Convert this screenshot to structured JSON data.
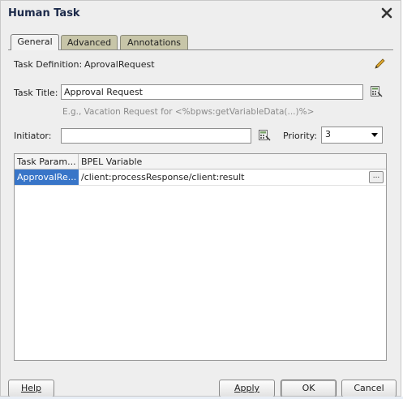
{
  "dialog": {
    "title": "Human Task"
  },
  "tabs": [
    {
      "label": "General",
      "active": true
    },
    {
      "label": "Advanced",
      "active": false
    },
    {
      "label": "Annotations",
      "active": false
    }
  ],
  "general": {
    "task_definition_label": "Task Definition:",
    "task_definition_value": "AprovalRequest",
    "task_title_label": "Task Title:",
    "task_title_value": "Approval Request",
    "task_title_hint": "E.g., Vacation Request for <%bpws:getVariableData(...)%>",
    "initiator_label": "Initiator:",
    "initiator_value": "",
    "priority_label": "Priority:",
    "priority_value": "3"
  },
  "table": {
    "headers": [
      "Task Param...",
      "BPEL Variable"
    ],
    "rows": [
      {
        "param": "ApprovalRe...",
        "variable": "/client:processResponse/client:result",
        "browse": "..."
      }
    ]
  },
  "buttons": {
    "help": "Help",
    "apply": "Apply",
    "ok": "OK",
    "cancel": "Cancel"
  },
  "colors": {
    "selection": "#3875c8",
    "inactive_tab": "#c7c5a8",
    "dialog_bg": "#eeeeee"
  },
  "icons": [
    "close-icon",
    "edit-pencil-icon",
    "expression-builder-icon"
  ]
}
